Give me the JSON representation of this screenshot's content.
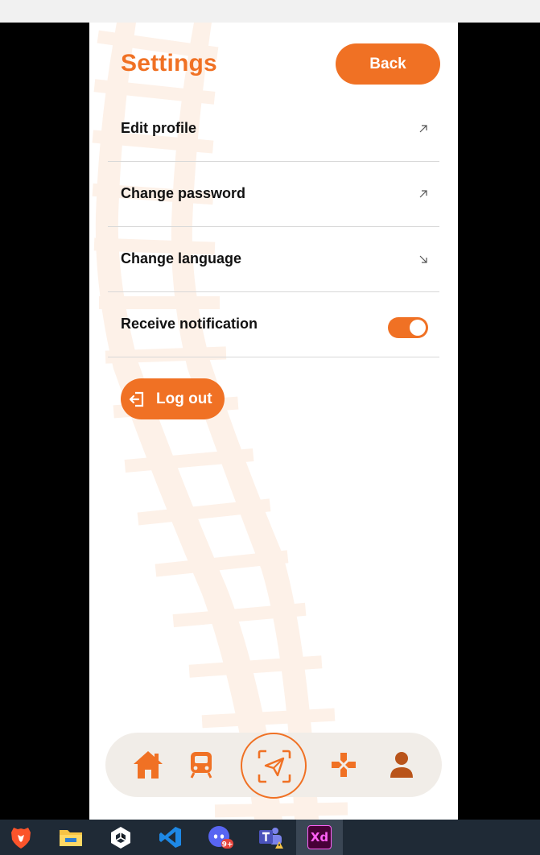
{
  "colors": {
    "accent": "#f07124",
    "rail": "#fdf1e8",
    "nav_background": "#f1ede8",
    "user_icon": "#b9541a"
  },
  "header": {
    "title": "Settings",
    "back_label": "Back"
  },
  "menu": {
    "items": [
      {
        "label": "Edit profile",
        "control": "arrow-up-right-icon"
      },
      {
        "label": "Change password",
        "control": "arrow-up-right-icon"
      },
      {
        "label": "Change language",
        "control": "arrow-down-right-icon"
      },
      {
        "label": "Receive notification",
        "control": "toggle",
        "toggle_on": true
      }
    ]
  },
  "logout": {
    "label": "Log out",
    "icon": "logout-icon"
  },
  "bottom_nav": {
    "items": [
      {
        "name": "home",
        "icon": "home-icon"
      },
      {
        "name": "train",
        "icon": "train-icon"
      },
      {
        "name": "scan",
        "icon": "scan-send-icon",
        "active": true
      },
      {
        "name": "game",
        "icon": "gamepad-icon"
      },
      {
        "name": "profile",
        "icon": "user-icon"
      }
    ]
  },
  "taskbar": {
    "apps": [
      {
        "name": "brave",
        "icon": "brave-icon"
      },
      {
        "name": "file-explorer",
        "icon": "folder-icon"
      },
      {
        "name": "unity",
        "icon": "unity-icon"
      },
      {
        "name": "vscode",
        "icon": "vscode-icon"
      },
      {
        "name": "discord",
        "icon": "discord-icon",
        "badge": "9+"
      },
      {
        "name": "teams",
        "icon": "teams-icon"
      },
      {
        "name": "adobe-xd",
        "icon": "xd-icon",
        "label": "Xd",
        "active": true
      }
    ]
  }
}
